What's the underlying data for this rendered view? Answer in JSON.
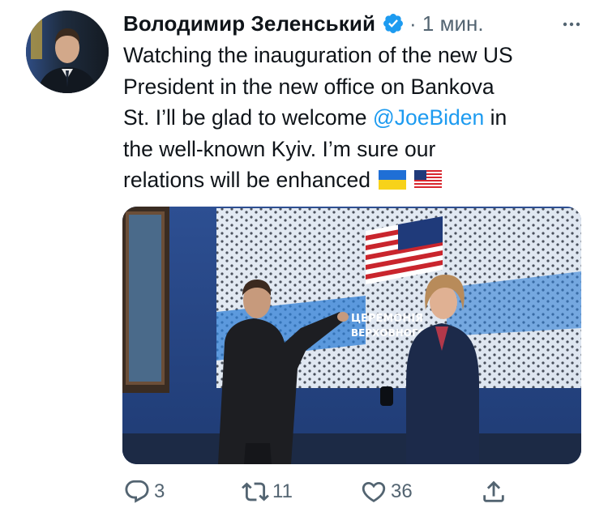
{
  "author": {
    "display_name": "Володимир Зеленський",
    "verified": true,
    "timestamp": "· 1 мин."
  },
  "tweet": {
    "lines": [
      "Watching the inauguration of the new US",
      "President in the new office on Bankova",
      "St. I’ll be glad to welcome ",
      "the well-known Kyiv. I’m sure our",
      "relations will be enhanced"
    ],
    "mention": "@JoeBiden",
    "mention_suffix": " in",
    "flags": [
      "flag-ukraine-icon",
      "flag-usa-icon"
    ]
  },
  "media": {
    "screen_caption_line1": "ЦЕРЕМОНІЯ",
    "screen_caption_line2": "ВЕРХОВНОГО"
  },
  "actions": {
    "reply_count": "3",
    "retweet_count": "11",
    "like_count": "36"
  },
  "colors": {
    "accent": "#1d9bf0",
    "secondary_text": "#536471",
    "primary_text": "#0f1419"
  }
}
